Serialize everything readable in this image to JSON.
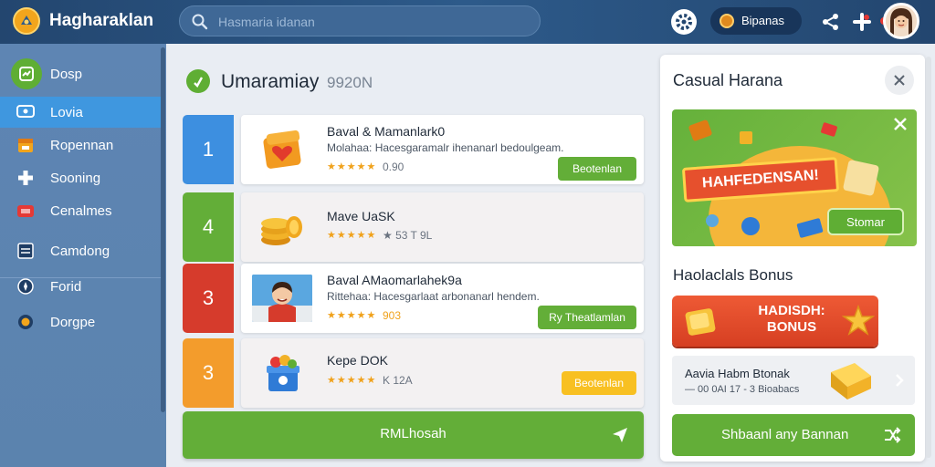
{
  "app": {
    "title": "Hagharaklan"
  },
  "search": {
    "placeholder": "Hasmaria idanan"
  },
  "header": {
    "coins_label": "Bipanas",
    "icons": [
      "gear-icon",
      "coin-icon",
      "share-icon",
      "notification-icon"
    ]
  },
  "sidebar": {
    "items": [
      {
        "label": "Dosp",
        "icon": "dashboard-icon",
        "icon_color": "#5fae34"
      },
      {
        "label": "Lovia",
        "icon": "monitor-icon",
        "active": true
      },
      {
        "label": "Ropennan",
        "icon": "calendar-icon",
        "icon_color": "#f2a51c"
      },
      {
        "label": "Sooning",
        "icon": "plus-icon"
      },
      {
        "label": "Cenalmes",
        "icon": "ticket-icon",
        "icon_color": "#e53935"
      },
      {
        "label": "Camdong",
        "icon": "window-icon"
      },
      {
        "label": "Forid",
        "icon": "compass-icon"
      },
      {
        "label": "Dorgpe",
        "icon": "badge-icon",
        "icon_color": "#f2a51c"
      }
    ]
  },
  "main": {
    "title": "Umaramiay",
    "subtitle": "9920N",
    "rows": [
      {
        "rank": "1",
        "rank_color": "#3d8fe0",
        "name": "Baval & Mamanlark0",
        "desc": "Molahaa: Hacesgaramalr ihenanarl bedoulgeam.",
        "stars": "★★★★★",
        "rating": "0.90",
        "button": "Beotenlan",
        "button_color": "#63ae38",
        "thumb": "heart-chest-icon"
      },
      {
        "rank": "4",
        "rank_color": "#63ae38",
        "name": "Mave UaSK",
        "desc": "",
        "stars": "★★★★★",
        "rating": "★ 53 T 9L",
        "button": "",
        "thumb": "coins-icon",
        "faded": true
      },
      {
        "rank": "3",
        "rank_color": "#d63b2c",
        "name": "Baval AMaomarlahek9a",
        "desc": "Rittehaa: Hacesgarlaat arbonanarl hendem.",
        "stars": "★★★★★",
        "rating": "903",
        "button": "Ry Theatlamlan",
        "button_color": "#63ae38",
        "thumb": "player-photo"
      },
      {
        "rank": "3",
        "rank_color": "#f39c2c",
        "name": "Kepe DOK",
        "desc": "",
        "stars": "★★★★★",
        "rating": "K 12A",
        "button": "Beotenlan",
        "button_color": "#f8c022",
        "thumb": "gift-box-icon",
        "faded": true
      }
    ],
    "cta": {
      "label": "RMLhosah",
      "icon": "send-icon"
    }
  },
  "right_panel": {
    "title": "Casual Harana",
    "promo": {
      "banner": "HAHFEDENSAN!",
      "button": "Stomar"
    },
    "section_title": "Haolaclals Bonus",
    "bonus_banner": "HADISDH: BONUS",
    "bonus_item": {
      "title": "Aavia Habm Btonak",
      "detail": "— 00 0AI 17 - 3 Bioabacs"
    },
    "cta": {
      "label": "Shbaanl any Bannan",
      "icon": "shuffle-icon"
    }
  }
}
